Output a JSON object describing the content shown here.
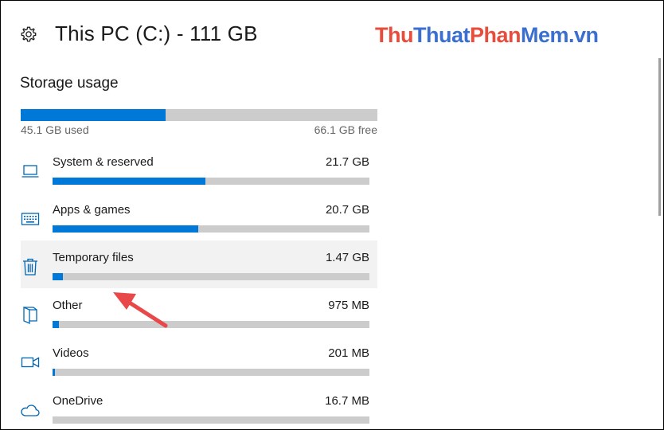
{
  "header": {
    "title": "This PC (C:) - 111 GB"
  },
  "watermark": {
    "part1": "Thu",
    "part2": "Thuat",
    "part3": "Phan",
    "part4": "Mem.vn"
  },
  "storage": {
    "section_title": "Storage usage",
    "used_label": "45.1 GB used",
    "free_label": "66.1 GB free",
    "used_fraction": 0.406
  },
  "items": [
    {
      "name": "System & reserved",
      "size": "21.7 GB",
      "fraction": 0.482,
      "icon": "laptop-icon"
    },
    {
      "name": "Apps & games",
      "size": "20.7 GB",
      "fraction": 0.46,
      "icon": "keyboard-icon"
    },
    {
      "name": "Temporary files",
      "size": "1.47 GB",
      "fraction": 0.033,
      "icon": "trash-icon"
    },
    {
      "name": "Other",
      "size": "975 MB",
      "fraction": 0.02,
      "icon": "folder-icon"
    },
    {
      "name": "Videos",
      "size": "201 MB",
      "fraction": 0.005,
      "icon": "video-camera-icon"
    },
    {
      "name": "OneDrive",
      "size": "16.7 MB",
      "fraction": 0.0,
      "icon": "cloud-icon"
    }
  ],
  "colors": {
    "accent": "#0078d7",
    "bar_track": "#cccccc",
    "highlight": "#f2f2f2",
    "annotation_arrow": "#e8484a"
  }
}
